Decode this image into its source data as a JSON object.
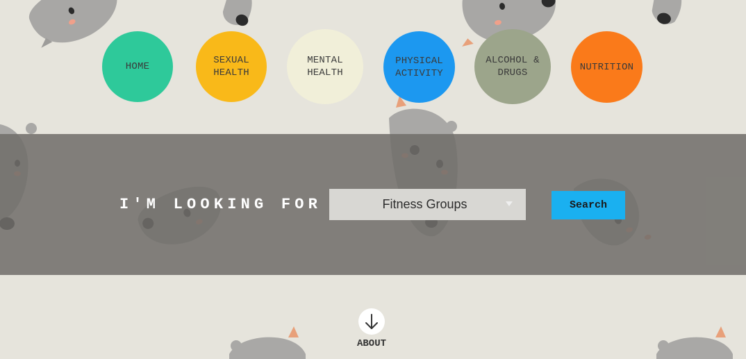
{
  "nav": {
    "items": [
      {
        "label": "HOME",
        "color": "#2ec99a"
      },
      {
        "label": "SEXUAL\nHEALTH",
        "color": "#f9b919"
      },
      {
        "label": "MENTAL\nHEALTH",
        "color": "#f1efd9"
      },
      {
        "label": "PHYSICAL\nACTIVITY",
        "color": "#1c98f0"
      },
      {
        "label": "ALCOHOL &\nDRUGS",
        "color": "#9ca58b"
      },
      {
        "label": "NUTRITION",
        "color": "#fa7a1a"
      }
    ]
  },
  "search": {
    "prompt": "I'M LOOKING FOR",
    "selected_option": "Fitness Groups",
    "button_label": "Search",
    "button_color": "#1ab0f0"
  },
  "about": {
    "label": "ABOUT",
    "icon": "arrow-down-icon"
  },
  "background": {
    "decoration": "cartoon-animal-heads"
  }
}
